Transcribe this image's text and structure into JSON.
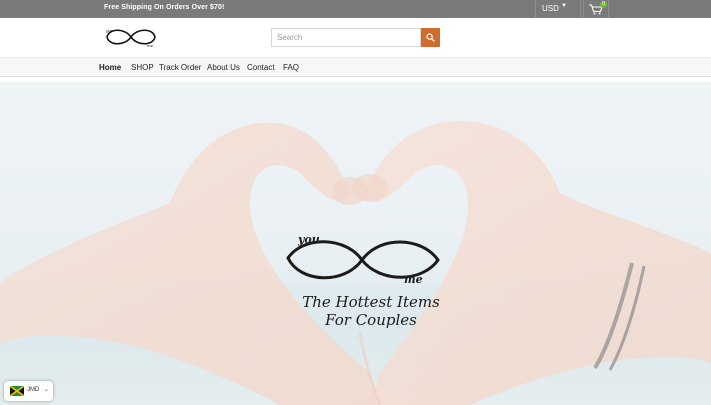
{
  "topbar": {
    "announcement": "Free Shipping On Orders Over $70!",
    "currency_label": "USD",
    "currency_caret": "▼",
    "cart_count": "0"
  },
  "header": {
    "search_placeholder": "Search"
  },
  "nav": {
    "items": [
      {
        "label": "Home"
      },
      {
        "label": "SHOP"
      },
      {
        "label": "Track Order"
      },
      {
        "label": "About Us"
      },
      {
        "label": "Contact"
      },
      {
        "label": "FAQ"
      }
    ]
  },
  "hero": {
    "logo_word_left": "you",
    "logo_word_right": "me",
    "tagline_line1": "The Hottest Items",
    "tagline_line2": "For Couples"
  },
  "currency_widget": {
    "code": "JMD",
    "chevron": "⌄"
  },
  "colors": {
    "topbar": "#7a7a7a",
    "search_button": "#d06c2e",
    "cart_badge": "#6cbf2a"
  }
}
